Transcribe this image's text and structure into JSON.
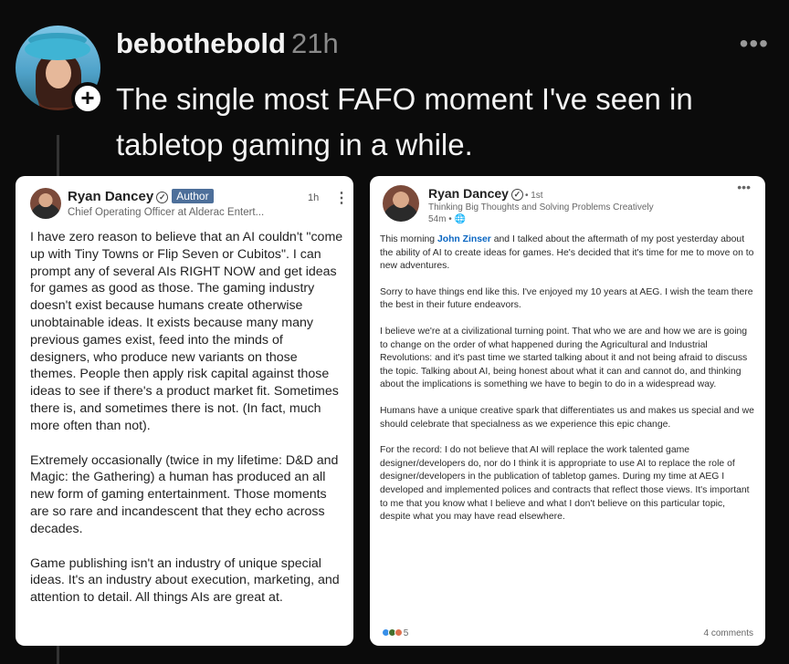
{
  "post": {
    "username": "bebothebold",
    "time": "21h",
    "more": "•••",
    "follow": "+",
    "text": "The single most FAFO moment I've seen in tabletop gaming in a while."
  },
  "left_card": {
    "name": "Ryan Dancey",
    "verified": "✓",
    "badge": "Author",
    "headline": "Chief Operating Officer at Alderac Entert...",
    "time": "1h",
    "kebab": "⋮",
    "paragraphs": [
      "I have zero reason to believe that an AI couldn't \"come up with Tiny Towns or Flip Seven or Cubitos\". I can prompt any of several AIs RIGHT NOW and get ideas for games as good as those. The gaming industry doesn't exist because humans create otherwise unobtainable ideas. It exists because many many previous games exist, feed into the minds of designers, who produce new variants on those themes. People then apply risk capital against those ideas to see if there's a product market fit. Sometimes there is, and sometimes there is not. (In fact, much more often than not).",
      "Extremely occasionally (twice in my lifetime: D&D and Magic: the Gathering) a human has produced an all new form of gaming entertainment. Those moments are so rare and incandescent that they echo across decades.",
      "Game publishing isn't an industry of unique special ideas. It's an industry about execution, marketing, and attention to detail. All things AIs are great at."
    ]
  },
  "right_card": {
    "name": "Ryan Dancey",
    "verified": "✓",
    "degree": "• 1st",
    "headline": "Thinking Big Thoughts and Solving Problems Creatively",
    "subline": "54m • 🌐",
    "more": "•••",
    "p1_pre": "This morning ",
    "mention": "John Zinser",
    "p1_post": " and I talked about the aftermath of my post yesterday about the ability of AI to create ideas for games. He's decided that it's time for me to move on to new adventures.",
    "p2": "Sorry to have things end like this. I've enjoyed my 10 years at AEG. I wish the team there the best in their future endeavors.",
    "p3": "I believe we're at a civilizational turning point. That who we are and how we are is going to change on the order of what happened during the Agricultural and Industrial Revolutions: and it's past time we started talking about it and not being afraid to discuss the topic. Talking about AI, being honest about what it can and cannot do, and thinking about the implications is something we have to begin to do in a widespread way.",
    "p4": "Humans have a unique creative spark that differentiates us and makes us special and we should celebrate that specialness as we experience this epic change.",
    "p5": "For the record: I do not believe that AI will replace the work talented game designer/developers do, nor do I think it is appropriate to use AI to replace the role of designer/developers in the publication of tabletop games. During my time at AEG I developed and implemented polices and contracts that reflect those views. It's important to me that you know what I believe and what I don't believe on this particular topic, despite what you may have read elsewhere.",
    "reaction_count": "5",
    "comments": "4 comments"
  },
  "colors": {
    "background": "#0b0b0b",
    "author_badge": "#4d6f9a",
    "mention": "#0a66c2"
  }
}
